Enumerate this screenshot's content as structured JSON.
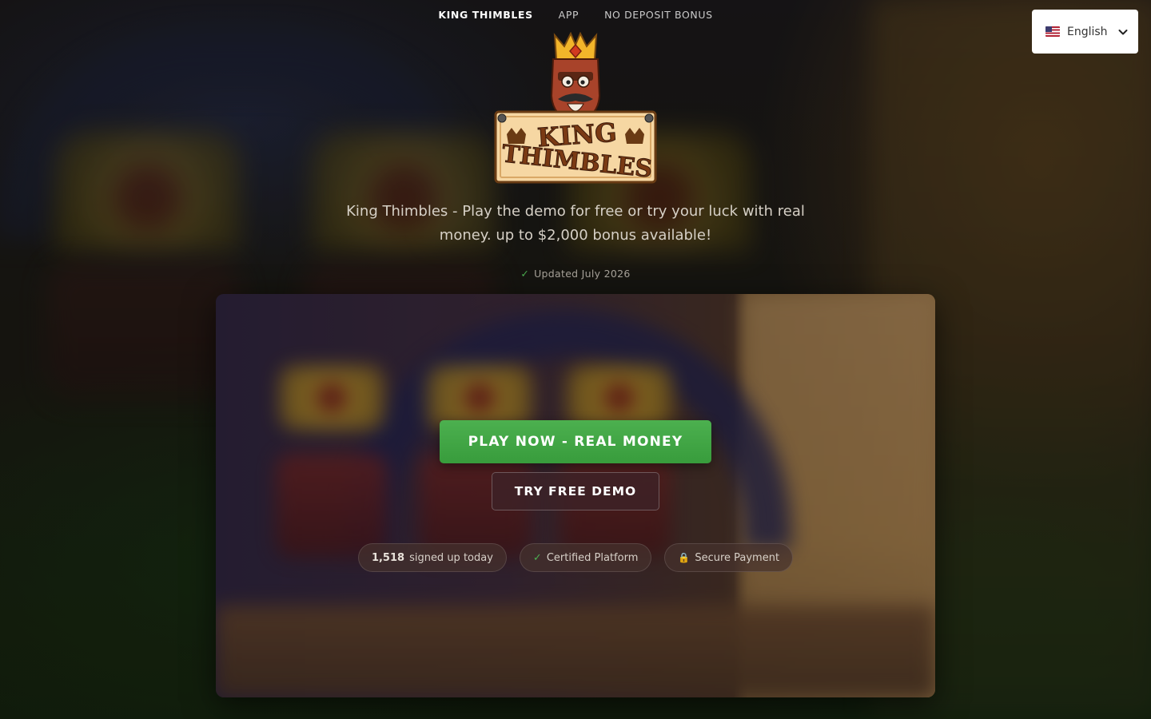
{
  "nav": {
    "items": [
      {
        "label": "KING THIMBLES",
        "active": true
      },
      {
        "label": "APP",
        "active": false
      },
      {
        "label": "NO DEPOSIT BONUS",
        "active": false
      }
    ]
  },
  "language": {
    "selected": "English",
    "flag_icon": "us-flag-icon",
    "chevron_icon": "chevron-down-icon"
  },
  "logo": {
    "line1": "KING",
    "line2": "THIMBLES"
  },
  "hero": {
    "tagline": "King Thimbles - Play the demo for free or try your luck with real money. up to $2,000 bonus available!",
    "updated_check": "✓",
    "updated": "Updated July 2026"
  },
  "card": {
    "play_button": "PLAY NOW - REAL MONEY",
    "demo_button": "TRY FREE DEMO",
    "badges": {
      "signups_count": "1,518",
      "signups_text": "signed up today",
      "certified_check": "✓",
      "certified": "Certified Platform",
      "secure_icon": "🔒",
      "secure": "Secure Payment"
    }
  },
  "colors": {
    "primary_green": "#4cb04f",
    "check_green": "#4caf50"
  }
}
